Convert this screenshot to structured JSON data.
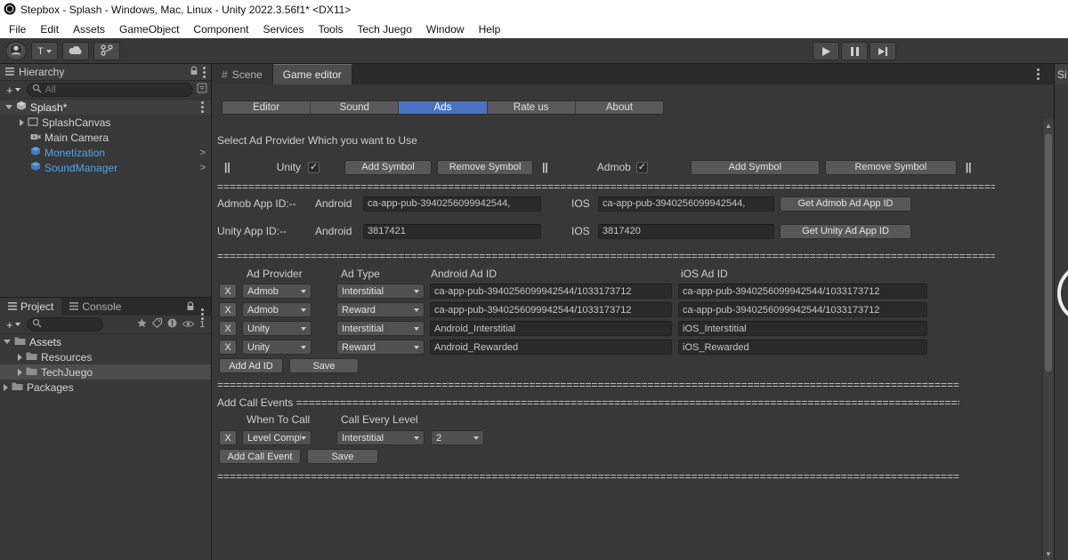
{
  "titlebar": {
    "title": "Stepbox - Splash - Windows, Mac, Linux - Unity 2022.3.56f1* <DX11>"
  },
  "menubar": {
    "items": [
      "File",
      "Edit",
      "Assets",
      "GameObject",
      "Component",
      "Services",
      "Tools",
      "Tech Juego",
      "Window",
      "Help"
    ]
  },
  "toolbar": {
    "account_label": "T"
  },
  "icons": {
    "check": "✓",
    "hash": "#",
    "chevron": ">",
    "plus": "+",
    "up_arrow": "▲",
    "down_arrow": "▼",
    "names": [
      "unity-logo-icon",
      "avatar-icon",
      "cloud-icon",
      "branch-icon",
      "play-icon",
      "pause-icon",
      "step-icon",
      "list-icon",
      "lock-icon",
      "kebab-icon",
      "search-icon",
      "filter-icon",
      "folder-icon",
      "cube-icon",
      "camera-icon",
      "canvas-icon",
      "prefab-icon",
      "star-icon",
      "tag-icon",
      "eye-icon",
      "grid-icon"
    ]
  },
  "hierarchy": {
    "tab": "Hierarchy",
    "search_placeholder": "All",
    "scene_label": "Splash*",
    "items": [
      {
        "label": "SplashCanvas"
      },
      {
        "label": "Main Camera"
      },
      {
        "label": "Monetization"
      },
      {
        "label": "SoundManager"
      }
    ]
  },
  "project": {
    "tab_project": "Project",
    "tab_console": "Console",
    "hidden_count": "1",
    "items": {
      "assets": "Assets",
      "resources": "Resources",
      "techjuego": "TechJuego",
      "packages": "Packages"
    }
  },
  "main": {
    "tab_scene": "Scene",
    "tab_game_editor": "Game editor",
    "right_panel_clip": "Si"
  },
  "editor": {
    "tabs": [
      "Editor",
      "Sound",
      "Ads",
      "Rate us",
      "About"
    ],
    "active_tab": "Ads",
    "heading": "Select Ad Provider Which you want to Use",
    "pipe": "||",
    "providers": [
      {
        "name": "Unity",
        "add": "Add Symbol",
        "remove": "Remove Symbol"
      },
      {
        "name": "Admob",
        "add": "Add  Symbol",
        "remove": "Remove Symbol"
      }
    ],
    "app_id_rows": [
      {
        "label": "Admob App ID:--",
        "android_label": "Android",
        "android_value": "ca-app-pub-3940256099942544,",
        "ios_label": "IOS",
        "ios_value": "ca-app-pub-3940256099942544,",
        "button": "Get Admob Ad App ID"
      },
      {
        "label": "Unity App ID:--",
        "android_label": "Android",
        "android_value": "3817421",
        "ios_label": "IOS",
        "ios_value": "3817420",
        "button": "Get Unity Ad App ID"
      }
    ],
    "table": {
      "headers": {
        "provider": "Ad Provider",
        "type": "Ad Type",
        "android": "Android Ad ID",
        "ios": "iOS Ad ID"
      },
      "rows": [
        {
          "remove": "X",
          "provider": "Admob",
          "type": "Interstitial",
          "android": "ca-app-pub-3940256099942544/1033173712",
          "ios": "ca-app-pub-3940256099942544/1033173712"
        },
        {
          "remove": "X",
          "provider": "Admob",
          "type": "Reward",
          "android": "ca-app-pub-3940256099942544/1033173712",
          "ios": "ca-app-pub-3940256099942544/1033173712"
        },
        {
          "remove": "X",
          "provider": "Unity",
          "type": "Interstitial",
          "android": "Android_Interstitial",
          "ios": "iOS_Interstitial"
        },
        {
          "remove": "X",
          "provider": "Unity",
          "type": "Reward",
          "android": "Android_Rewarded",
          "ios": "iOS_Rewarded"
        }
      ],
      "add_button": "Add Ad ID",
      "save_button": "Save"
    },
    "call_events": {
      "title": "Add Call Events ",
      "when_header": "When To Call",
      "every_header": "Call Every Level",
      "row": {
        "remove": "X",
        "when": "Level Complet",
        "type": "Interstitial",
        "level": "2"
      },
      "add_button": "Add Call Event",
      "save_button": "Save"
    },
    "sep": "======================================================================================================================================================"
  }
}
